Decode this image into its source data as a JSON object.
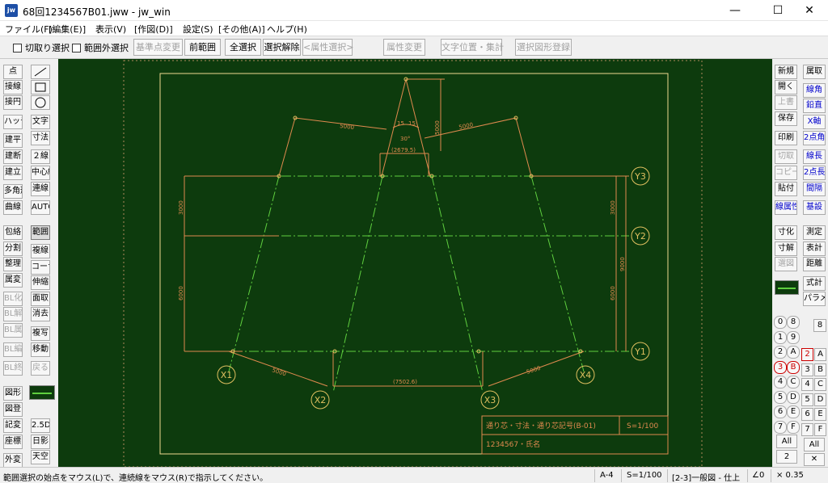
{
  "window": {
    "title": "68回1234567B01.jww - jw_win",
    "app_icon": "jw",
    "minimize": "—",
    "maximize": "☐",
    "close": "✕"
  },
  "menu": [
    "ファイル(F)",
    "[編集(E)]",
    "表示(V)",
    "[作図(D)]",
    "設定(S)",
    "[その他(A)]",
    "ヘルプ(H)"
  ],
  "toolbar": {
    "chk_cut": "切取り選択",
    "chk_outside": "範囲外選択",
    "buttons": [
      "基準点変更",
      "前範囲",
      "全選択",
      "選択解除",
      "<属性選択>",
      "属性変更",
      "文字位置・集計",
      "選択図形登録"
    ]
  },
  "left_tools": [
    "点",
    "接線",
    "接円",
    "ハッチ",
    "建平",
    "建断",
    "建立",
    "多角形",
    "曲線",
    "包絡",
    "分割",
    "整理",
    "属変",
    "BL化",
    "BL解",
    "BL属",
    "BL編",
    "BL終",
    "図形",
    "図登",
    "記変",
    "座標",
    "外変",
    "／",
    "□",
    "○",
    "文字",
    "寸法",
    "２線",
    "中心線",
    "連線",
    "AUTO",
    "範囲",
    "複線",
    "コーナー",
    "伸縮",
    "面取",
    "消去",
    "複写",
    "移動",
    "戻る",
    "2.5D",
    "日影",
    "天空"
  ],
  "right_tools": [
    "新規",
    "開く",
    "上書",
    "保存",
    "印刷",
    "切取",
    "コピー",
    "貼付",
    "線属性",
    "寸化",
    "寸解",
    "選図",
    "式計",
    "パラメ",
    "属取",
    "線角",
    "鉛直",
    "X軸",
    "2点角",
    "線長",
    "2点長",
    "間隔",
    "基設",
    "測定",
    "表計",
    "距離"
  ],
  "layers": {
    "group_nums": [
      "0",
      "1",
      "2",
      "3",
      "4",
      "5",
      "6",
      "7"
    ],
    "group_letters": [
      "8",
      "9",
      "A",
      "B",
      "C",
      "D",
      "E",
      "F"
    ],
    "layer_nums": [
      "2",
      "3",
      "4",
      "5",
      "6",
      "7"
    ],
    "layer_letters": [
      "A",
      "B",
      "C",
      "D",
      "E",
      "F"
    ],
    "top_right": "8",
    "all_left": "All",
    "all_left_num": "2",
    "all_right": "All",
    "x_button": "✕"
  },
  "drawing": {
    "grid_y": [
      "Y3",
      "Y2",
      "Y1"
    ],
    "grid_x": [
      "X1",
      "X2",
      "X3",
      "X4"
    ],
    "dims": {
      "top_left": "5000",
      "top_right": "5000",
      "top_vertical": "5000",
      "angle_left": "15",
      "angle_right": "15",
      "angle_total": "30°",
      "top_width": "(2679.5)",
      "bottom_width": "(7502.6)",
      "bottom_left": "5000",
      "bottom_right": "5000",
      "left_upper": "3000",
      "left_lower": "6000",
      "right_upper": "3000",
      "right_total": "9000",
      "right_lower": "6000"
    },
    "title_block": {
      "title": "通り芯・寸法・通り芯記号(B-01)",
      "scale": "S=1/100",
      "name": "1234567・氏名"
    }
  },
  "status": {
    "message": "範囲選択の始点をマウス(L)で、連続線をマウス(R)で指示してください。",
    "paper": "A-4",
    "scale": "S=1/100",
    "layer": "[2-3]一般図 - 仕上",
    "angle": "∠0",
    "zoom": "× 0.35"
  },
  "colors": {
    "canvas": "#0d3b0d",
    "orange": "#e08a4f",
    "green": "#5fcf3f",
    "frame": "#f0d890"
  }
}
